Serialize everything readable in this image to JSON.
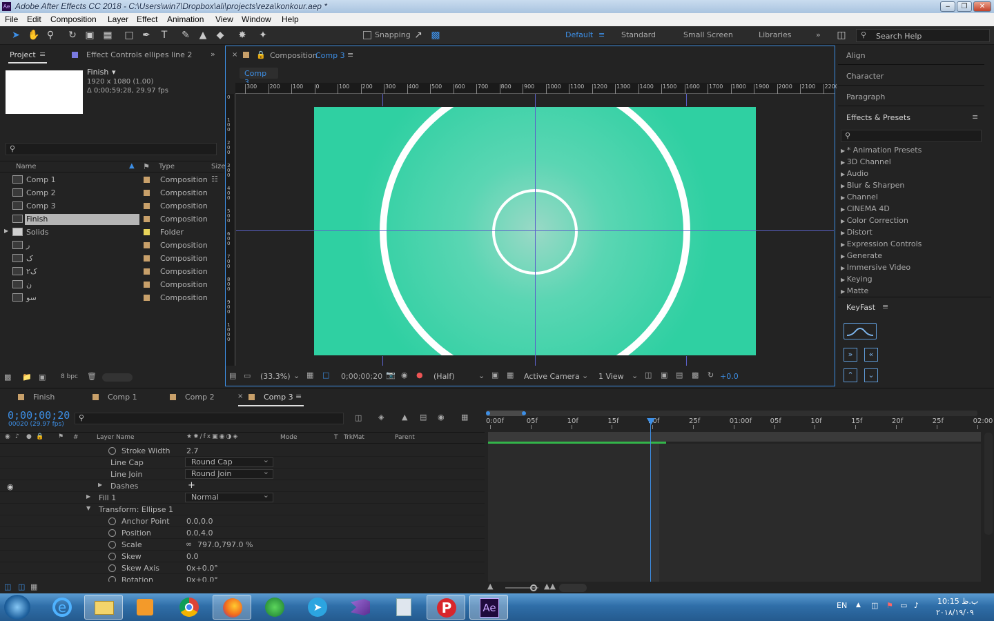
{
  "window": {
    "title": "Adobe After Effects CC 2018 - C:\\Users\\win7\\Dropbox\\ali\\projects\\reza\\konkour.aep *",
    "app_icon": "Ae"
  },
  "menu": [
    "File",
    "Edit",
    "Composition",
    "Layer",
    "Effect",
    "Animation",
    "View",
    "Window",
    "Help"
  ],
  "toolbar": {
    "snapping": "Snapping",
    "workspaces": [
      "Default",
      "Standard",
      "Small Screen",
      "Libraries"
    ],
    "search_placeholder": "Search Help"
  },
  "project": {
    "tab": "Project",
    "effect_controls_tab": "Effect Controls ellipes line 2",
    "selected_name": "Finish",
    "info1": "1920 x 1080 (1.00)",
    "info2": "Δ 0;00;59;28, 29.97 fps",
    "columns": [
      "Name",
      "Type",
      "Size"
    ],
    "items": [
      {
        "name": "Comp 1",
        "type": "Composition",
        "color": "#c8a06a"
      },
      {
        "name": "Comp 2",
        "type": "Composition",
        "color": "#c8a06a"
      },
      {
        "name": "Comp 3",
        "type": "Composition",
        "color": "#c8a06a"
      },
      {
        "name": "Finish",
        "type": "Composition",
        "color": "#c8a06a",
        "selected": true
      },
      {
        "name": "Solids",
        "type": "Folder",
        "color": "#e8d45a",
        "folder": true
      },
      {
        "name": "ر",
        "type": "Composition",
        "color": "#c8a06a"
      },
      {
        "name": "ک",
        "type": "Composition",
        "color": "#c8a06a"
      },
      {
        "name": "ک۲",
        "type": "Composition",
        "color": "#c8a06a"
      },
      {
        "name": "ن",
        "type": "Composition",
        "color": "#c8a06a"
      },
      {
        "name": "سو",
        "type": "Composition",
        "color": "#c8a06a"
      }
    ],
    "bpc": "8 bpc"
  },
  "composition": {
    "tab_prefix": "Composition",
    "tab_name": "Comp 3",
    "sub_tab": "Comp 3",
    "ruler": [
      "300",
      "200",
      "100",
      "0",
      "100",
      "200",
      "300",
      "400",
      "500",
      "600",
      "700",
      "800",
      "900",
      "1000",
      "1100",
      "1200",
      "1300",
      "1400",
      "1500",
      "1600",
      "1700",
      "1800",
      "1900",
      "2000",
      "2100",
      "2200"
    ],
    "vruler": [
      "0",
      "100",
      "200",
      "300",
      "400",
      "500",
      "600",
      "700",
      "800",
      "900",
      "1000"
    ],
    "zoom": "(33.3%)",
    "timecode": "0;00;00;20",
    "resolution": "(Half)",
    "camera": "Active Camera",
    "views": "1 View",
    "exposure": "+0.0",
    "canvas_color": "#2fd0a2"
  },
  "right_panels": {
    "align": "Align",
    "character": "Character",
    "paragraph": "Paragraph",
    "effects_presets": "Effects & Presets",
    "effects": [
      "* Animation Presets",
      "3D Channel",
      "Audio",
      "Blur & Sharpen",
      "Channel",
      "CINEMA 4D",
      "Color Correction",
      "Distort",
      "Expression Controls",
      "Generate",
      "Immersive Video",
      "Keying",
      "Matte"
    ],
    "keyfast": "KeyFast"
  },
  "timeline": {
    "tabs": [
      "Finish",
      "Comp 1",
      "Comp 2",
      "Comp 3"
    ],
    "timecode": "0;00;00;20",
    "fps": "00020 (29.97 fps)",
    "columns": {
      "layer_name": "Layer Name",
      "mode": "Mode",
      "t": "T",
      "trkmat": "TrkMat",
      "parent": "Parent"
    },
    "ruler": [
      "0:00f",
      "05f",
      "10f",
      "15f",
      "20f",
      "25f",
      "01:00f",
      "05f",
      "10f",
      "15f",
      "20f",
      "25f",
      "02:00"
    ],
    "props": [
      {
        "name": "Stroke Width",
        "value": "2.7",
        "stopwatch": true,
        "indent": 176
      },
      {
        "name": "Line Cap",
        "dropdown": "Round Cap",
        "indent": 160
      },
      {
        "name": "Line Join",
        "dropdown": "Round Join",
        "indent": 160
      },
      {
        "name": "Dashes",
        "indent": 160,
        "arrow": "▶",
        "plus": "+"
      },
      {
        "name": "Fill 1",
        "dropdown": "Normal",
        "indent": 143,
        "arrow": "▶"
      },
      {
        "name": "Transform: Ellipse 1",
        "indent": 143,
        "arrow": "▼"
      },
      {
        "name": "Anchor Point",
        "value": "0.0,0.0",
        "stopwatch": true,
        "indent": 176
      },
      {
        "name": "Position",
        "value": "0.0,4.0",
        "stopwatch": true,
        "indent": 176
      },
      {
        "name": "Scale",
        "value": "797.0,797.0 %",
        "stopwatch": true,
        "indent": 176,
        "link": true
      },
      {
        "name": "Skew",
        "value": "0.0",
        "stopwatch": true,
        "indent": 176
      },
      {
        "name": "Skew Axis",
        "value": "0x+0.0°",
        "stopwatch": true,
        "indent": 176
      },
      {
        "name": "Rotation",
        "value": "0x+0.0°",
        "stopwatch": true,
        "indent": 176
      }
    ]
  },
  "taskbar": {
    "lang": "EN",
    "time": "10:15 ب.ظ",
    "date": "۲۰۱۸/۱۹/۰۹"
  }
}
